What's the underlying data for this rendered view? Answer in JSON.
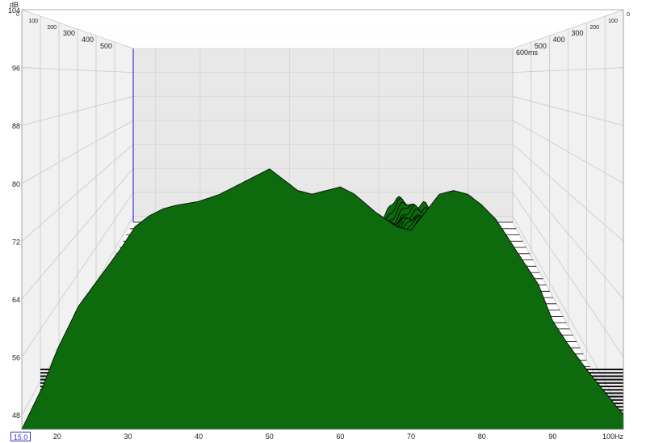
{
  "chart_data": {
    "type": "area",
    "subtype": "waterfall-3d",
    "xlabel": "Hz",
    "ylabel": "dB",
    "ylim": [
      46,
      104
    ],
    "xlim": [
      15,
      100
    ],
    "y_ticks": [
      "48",
      "56",
      "64",
      "72",
      "80",
      "88",
      "96",
      "104"
    ],
    "y_tick_values": [
      48,
      56,
      64,
      72,
      80,
      88,
      96,
      104
    ],
    "x_ticks": [
      "20",
      "30",
      "40",
      "50",
      "60",
      "70",
      "80",
      "90",
      "100Hz"
    ],
    "x_tick_values": [
      20,
      30,
      40,
      50,
      60,
      70,
      80,
      90,
      100
    ],
    "time_ticks": [
      "0",
      "100",
      "200",
      "300",
      "400",
      "500",
      "600ms"
    ],
    "time_tick_values": [
      0,
      100,
      200,
      300,
      400,
      500,
      600
    ],
    "cursor_frequency": "15.0",
    "cursor_frequency_value": 15.0,
    "front_slice_response": {
      "frequency_hz": [
        15,
        18,
        20,
        23,
        26,
        29,
        31,
        33,
        35,
        37,
        40,
        43,
        46,
        48,
        50,
        52,
        54,
        56,
        58,
        60,
        62,
        65,
        68,
        70,
        72,
        74,
        76,
        78,
        80,
        82,
        84,
        86,
        88,
        90,
        92,
        95,
        100
      ],
      "level_db": [
        46,
        52,
        57,
        63,
        67,
        71,
        74,
        75.5,
        76.5,
        77,
        77.5,
        78.5,
        80,
        81,
        82,
        80.5,
        79,
        78.5,
        79,
        79.5,
        78.5,
        76,
        74,
        73.5,
        76,
        78.5,
        79,
        78.5,
        77,
        75,
        72,
        69,
        66,
        61,
        58,
        54,
        48
      ]
    },
    "colors": {
      "fill": "#0d6a0d",
      "outline": "#000000",
      "cursor": "#3b3bd9",
      "background": "#ffffff",
      "grid": "#c8c8c8"
    },
    "grid": true
  }
}
